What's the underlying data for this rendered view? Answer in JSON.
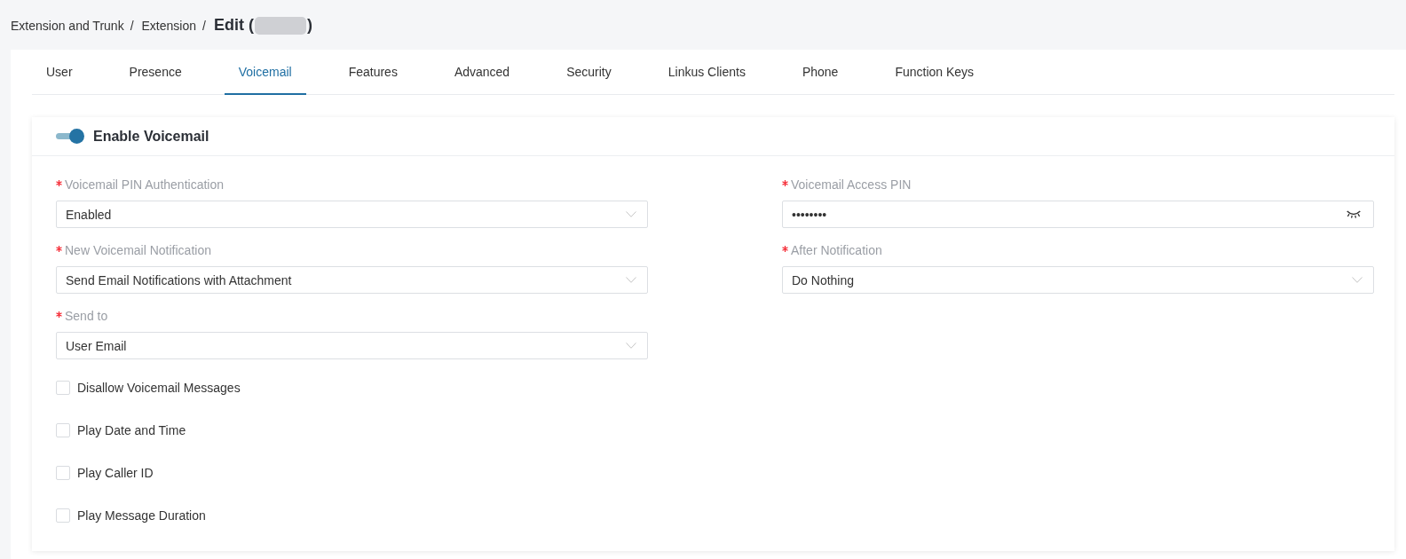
{
  "breadcrumb": [
    {
      "label": "Extension and Trunk",
      "separator": "/"
    },
    {
      "label": "Extension",
      "separator": "/"
    }
  ],
  "title": {
    "prefix": "Edit (",
    "redacted": true,
    "suffix": ")"
  },
  "tabs": [
    {
      "label": "User",
      "selected": false
    },
    {
      "label": "Presence",
      "selected": false
    },
    {
      "label": "Voicemail",
      "selected": true
    },
    {
      "label": "Features",
      "selected": false
    },
    {
      "label": "Advanced",
      "selected": false
    },
    {
      "label": "Security",
      "selected": false
    },
    {
      "label": "Linkus Clients",
      "selected": false
    },
    {
      "label": "Phone",
      "selected": false
    },
    {
      "label": "Function Keys",
      "selected": false
    }
  ],
  "panel": {
    "toggle": {
      "label": "Enable Voicemail",
      "on": true
    },
    "fields": [
      {
        "kind": "select",
        "label": "Voicemail PIN Authentication",
        "required": true,
        "value": "Enabled"
      },
      {
        "kind": "password",
        "label": "Voicemail Access PIN",
        "required": true,
        "value": "••••••••"
      },
      {
        "kind": "select",
        "label": "New Voicemail Notification",
        "required": true,
        "value": "Send Email Notifications with Attachment"
      },
      {
        "kind": "select",
        "label": "After Notification",
        "required": true,
        "value": "Do Nothing"
      },
      {
        "kind": "select",
        "label": "Send to",
        "required": true,
        "value": "User Email"
      }
    ],
    "checkboxes": [
      {
        "label": "Disallow Voicemail Messages",
        "checked": false
      },
      {
        "label": "Play Date and Time",
        "checked": false
      },
      {
        "label": "Play Caller ID",
        "checked": false
      },
      {
        "label": "Play Message Duration",
        "checked": false
      }
    ]
  }
}
